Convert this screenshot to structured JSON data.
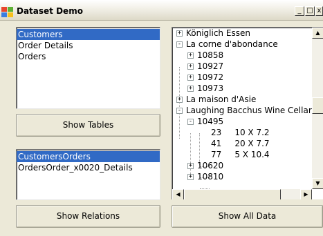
{
  "window": {
    "title": "Dataset Demo",
    "controls": {
      "minimize": "_",
      "maximize": "□",
      "close": "x"
    }
  },
  "tables_list": {
    "items": [
      "Customers",
      "Order Details",
      "Orders"
    ],
    "selected": "Customers"
  },
  "show_tables_label": "Show Tables",
  "relations_list": {
    "items": [
      "CustomersOrders",
      "OrdersOrder_x0020_Details"
    ],
    "selected": "CustomersOrders"
  },
  "show_relations_label": "Show Relations",
  "show_all_data_label": "Show All Data",
  "tree": {
    "nodes": [
      {
        "text": "Königlich Essen",
        "level": 0,
        "expander": "+"
      },
      {
        "text": "La corne d'abondance",
        "level": 0,
        "expander": "-"
      },
      {
        "text": "10858",
        "level": 1,
        "expander": "+"
      },
      {
        "text": "10927",
        "level": 1,
        "expander": "+"
      },
      {
        "text": "10972",
        "level": 1,
        "expander": "+"
      },
      {
        "text": "10973",
        "level": 1,
        "expander": "+"
      },
      {
        "text": "La maison d'Asie",
        "level": 0,
        "expander": "+"
      },
      {
        "text": "Laughing Bacchus Wine Cellars",
        "level": 0,
        "expander": "-"
      },
      {
        "text": "10495",
        "level": 1,
        "expander": "-"
      },
      {
        "text": "23     10 X 7.2",
        "level": 2,
        "expander": ""
      },
      {
        "text": "41     20 X 7.7",
        "level": 2,
        "expander": ""
      },
      {
        "text": "77     5 X 10.4",
        "level": 2,
        "expander": ""
      },
      {
        "text": "10620",
        "level": 1,
        "expander": "+"
      },
      {
        "text": "10810",
        "level": 1,
        "expander": "+"
      }
    ]
  },
  "scrollbars": {
    "up": "▲",
    "down": "▼",
    "left": "◀",
    "right": "▶"
  },
  "icons": {
    "app": "windows-logo-icon",
    "scroll_up": "scroll-up-arrow-icon",
    "scroll_down": "scroll-down-arrow-icon",
    "scroll_left": "scroll-left-arrow-icon",
    "scroll_right": "scroll-right-arrow-icon"
  },
  "colors": {
    "window_bg": "#ece9d8",
    "selection": "#316ac5",
    "selection_text": "#ffffff",
    "list_bg": "#ffffff"
  }
}
